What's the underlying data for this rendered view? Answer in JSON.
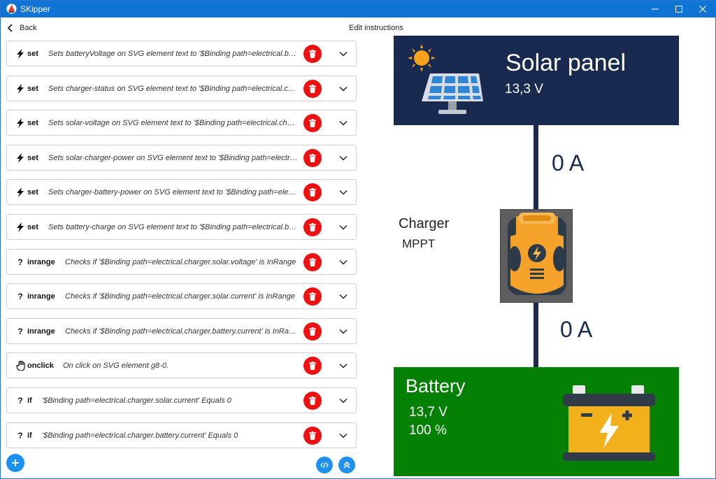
{
  "window": {
    "title": "SKipper"
  },
  "header": {
    "back_label": "Back",
    "page_title": "Edit instructions"
  },
  "instructions": [
    {
      "icon": "lightning-icon",
      "keyword": "set",
      "desc": "Sets batteryVoltage on SVG element text to '$Binding path=electrical.battery.voltage'"
    },
    {
      "icon": "lightning-icon",
      "keyword": "set",
      "desc": "Sets charger-status on SVG element text to '$Binding path=electrical.charger.status'"
    },
    {
      "icon": "lightning-icon",
      "keyword": "set",
      "desc": "Sets solar-voltage on SVG element text to '$Binding path=electrical.charger.solar.voltage'"
    },
    {
      "icon": "lightning-icon",
      "keyword": "set",
      "desc": "Sets solar-charger-power on SVG element text to '$Binding path=electrical.charger.solar.current'"
    },
    {
      "icon": "lightning-icon",
      "keyword": "set",
      "desc": "Sets charger-battery-power on SVG element text to '$Binding path=electrical.charger.battery.current'"
    },
    {
      "icon": "lightning-icon",
      "keyword": "set",
      "desc": "Sets battery-charge on SVG element text to '$Binding path=electrical.battery.charge'"
    },
    {
      "icon": "question-icon",
      "keyword": "inrange",
      "desc": "Checks if '$Binding path=electrical.charger.solar.voltage' is InRange"
    },
    {
      "icon": "question-icon",
      "keyword": "inrange",
      "desc": "Checks if '$Binding path=electrical.charger.solar.current' is InRange"
    },
    {
      "icon": "question-icon",
      "keyword": "inrange",
      "desc": "Checks if '$Binding path=electrical.charger.battery.current' is InRange"
    },
    {
      "icon": "hand-icon",
      "keyword": "onclick",
      "desc": "On click on SVG element g8-0."
    },
    {
      "icon": "question-icon",
      "keyword": "if",
      "desc": "'$Binding path=electrical.charger.solar.current' Equals 0"
    },
    {
      "icon": "question-icon",
      "keyword": "if",
      "desc": "'$Binding path=electrical.charger.battery.current' Equals 0"
    }
  ],
  "diagram": {
    "solar_title": "Solar panel",
    "solar_voltage": "13,3 V",
    "solar_current": "0 A",
    "charger_label": "Charger",
    "charger_mode": "MPPT",
    "battery_current": "0 A",
    "battery_title": "Battery",
    "battery_voltage": "13,7 V",
    "battery_charge": "100 %"
  },
  "colors": {
    "titlebar": "#0f74d4",
    "delete": "#ee1111",
    "fab": "#1e90f0",
    "solar_panel_bg": "#182a4f",
    "battery_bg": "#048004"
  }
}
